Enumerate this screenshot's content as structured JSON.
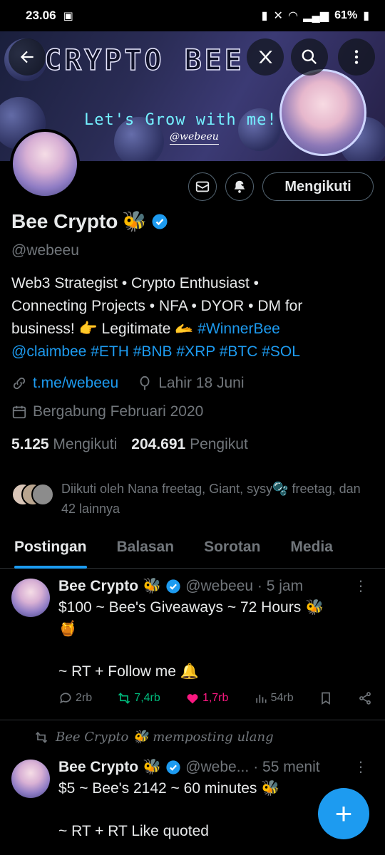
{
  "status_bar": {
    "time": "23.06",
    "battery": "61%"
  },
  "banner": {
    "title": "CRYPTO BEE",
    "subtitle": "Let's Grow with me!",
    "handle": "@webeeu",
    "buttons": [
      "back-icon",
      "translate-icon",
      "search-icon",
      "more-icon"
    ]
  },
  "actions": {
    "follow_label": "Mengikuti"
  },
  "profile": {
    "name": "Bee Crypto",
    "name_emoji": "🐝",
    "handle": "@webeeu",
    "bio_line1": "Web3 Strategist • Crypto Enthusiast •",
    "bio_line2": "Connecting Projects • NFA •  DYOR • DM for",
    "bio_line3_text": "business! 👉 Legitimate 🫴 ",
    "bio_line3_tag": "#WinnerBee",
    "bio_line4": "@claimbee #ETH #BNB #XRP #BTC #SOL",
    "website": "t.me/webeeu",
    "birthday": "Lahir 18 Juni",
    "joined": "Bergabung Februari 2020",
    "following_count": "5.125",
    "following_label": "Mengikuti",
    "followers_count": "204.691",
    "followers_label": "Pengikut",
    "followed_by": "Diikuti oleh Nana freetag, Giant, sysy🫧 freetag, dan 42 lainnya"
  },
  "tabs": [
    "Postingan",
    "Balasan",
    "Sorotan",
    "Media"
  ],
  "tweet1": {
    "name": "Bee Crypto",
    "emoji": "🐝",
    "handle_time": "@webeeu · 5 jam",
    "text": "$100 ~ Bee's Giveaways ~ 72 Hours 🐝\n🍯\n\n~ RT + Follow me 🔔",
    "replies": "2rb",
    "reposts": "7,4rb",
    "likes": "1,7rb",
    "views": "54rb"
  },
  "repost_notice": "Bee Crypto 🐝 memposting ulang",
  "tweet2": {
    "name": "Bee Crypto",
    "emoji": "🐝",
    "handle": "@webe...",
    "time": "· 55 menit",
    "text": "$5 ~ Bee's 2142 ~ 60 minutes 🐝\n\n~ RT + RT Like quoted"
  },
  "fab_label": "+",
  "colors": {
    "accent": "#1d9bf0",
    "repost": "#00ba7c",
    "like": "#f91880",
    "muted": "#71767b"
  }
}
